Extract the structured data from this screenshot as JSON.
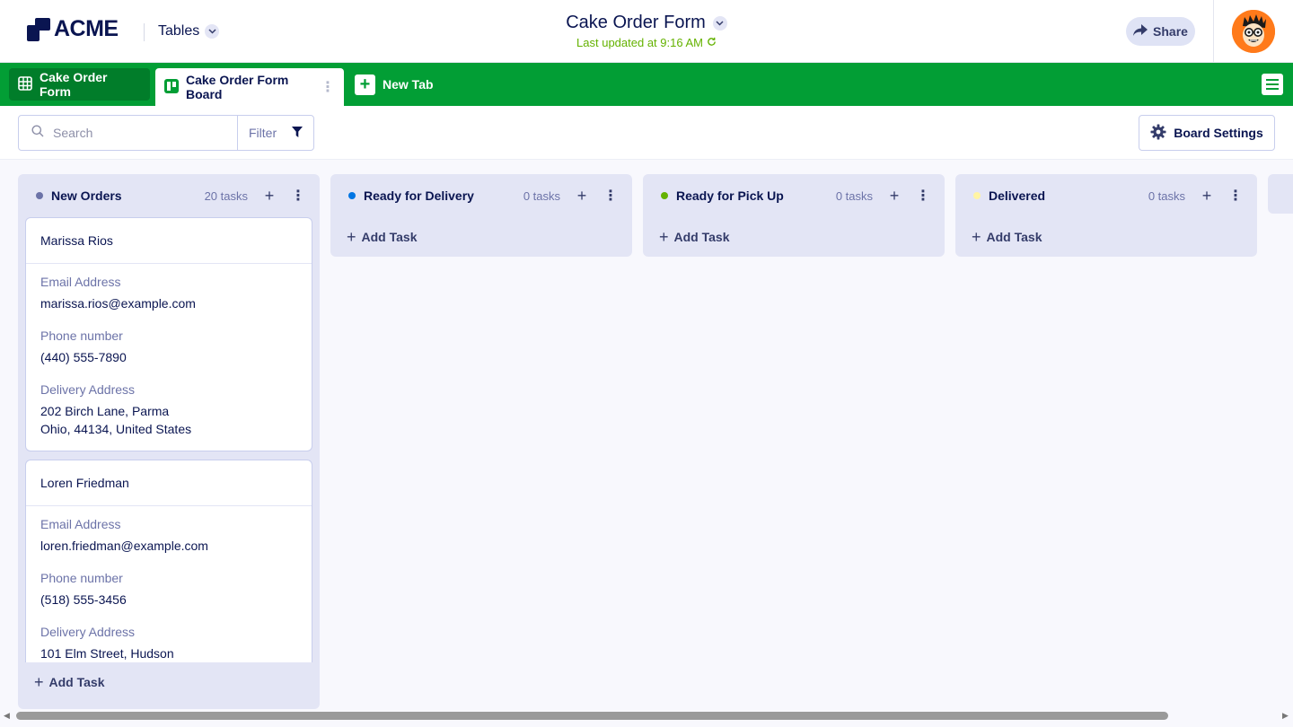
{
  "header": {
    "logo_text": "ACME",
    "tables_label": "Tables",
    "form_title": "Cake Order Form",
    "last_updated": "Last updated at 9:16 AM",
    "share_label": "Share"
  },
  "tabs": [
    {
      "label": "Cake Order Form",
      "icon": "grid-icon",
      "active": false
    },
    {
      "label": "Cake Order Form Board",
      "icon": "board-icon",
      "active": true
    }
  ],
  "new_tab_label": "New Tab",
  "toolbar": {
    "search_placeholder": "Search",
    "filter_label": "Filter",
    "board_settings_label": "Board Settings"
  },
  "columns": [
    {
      "name": "New Orders",
      "count": "20 tasks",
      "dot_color": "#6c73a8"
    },
    {
      "name": "Ready for Delivery",
      "count": "0 tasks",
      "dot_color": "#0075e3"
    },
    {
      "name": "Ready for Pick Up",
      "count": "0 tasks",
      "dot_color": "#64b200"
    },
    {
      "name": "Delivered",
      "count": "0 tasks",
      "dot_color": "#fff4a3"
    }
  ],
  "add_task_label": "Add Task",
  "cards": [
    {
      "name": "Marissa Rios",
      "email_label": "Email Address",
      "email": "marissa.rios@example.com",
      "phone_label": "Phone number",
      "phone": "(440) 555-7890",
      "address_label": "Delivery Address",
      "address_line1": "202 Birch Lane, Parma",
      "address_line2": "Ohio, 44134, United States"
    },
    {
      "name": "Loren Friedman",
      "email_label": "Email Address",
      "email": "loren.friedman@example.com",
      "phone_label": "Phone number",
      "phone": "(518) 555-3456",
      "address_label": "Delivery Address",
      "address_line1": "101 Elm Street, Hudson",
      "address_line2": ""
    }
  ],
  "colors": {
    "brand_green": "#029e35",
    "navy": "#0a1551",
    "updated_green": "#64b200"
  }
}
